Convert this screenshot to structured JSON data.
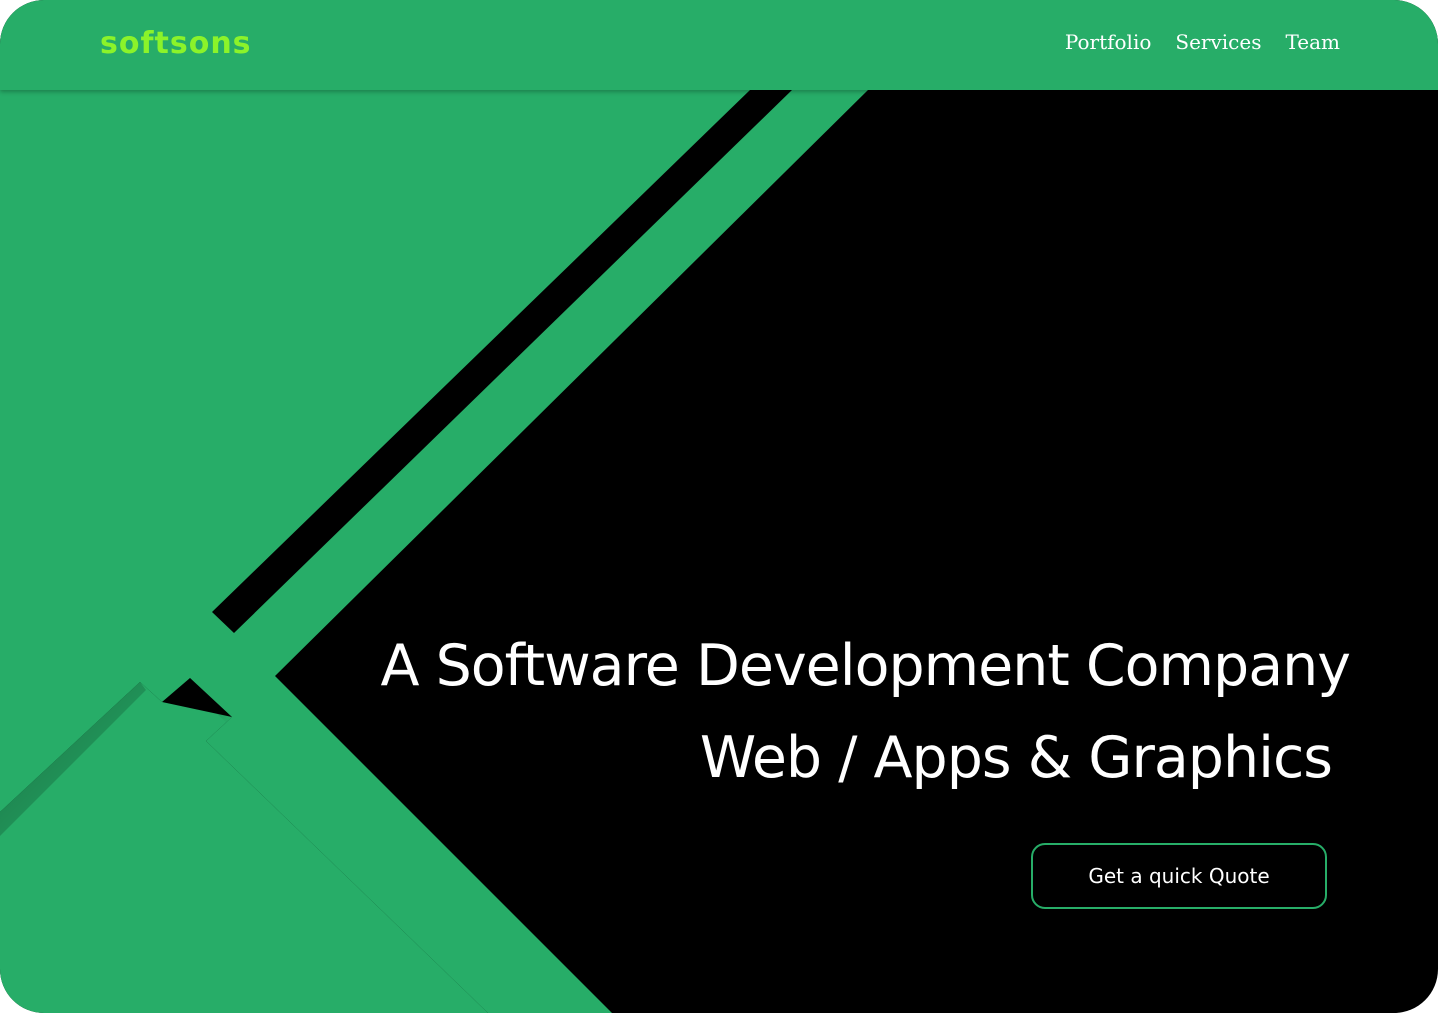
{
  "brand": {
    "name": "softsons"
  },
  "nav": {
    "items": [
      {
        "label": "Portfolio"
      },
      {
        "label": "Services"
      },
      {
        "label": "Team"
      }
    ]
  },
  "hero": {
    "headline_line1": "A Software Development Company",
    "headline_line2": "Web / Apps & Graphics",
    "cta_label": "Get a quick Quote"
  },
  "colors": {
    "primary_green": "#27ad68",
    "logo_green": "#8bf32a",
    "background": "#000000",
    "text": "#ffffff"
  }
}
